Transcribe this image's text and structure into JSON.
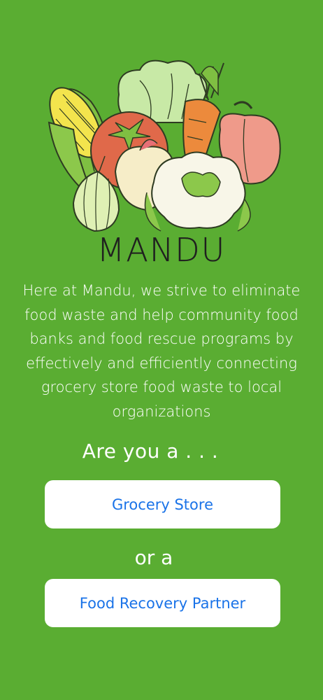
{
  "app": {
    "brand_name": "MANDU"
  },
  "intro": {
    "mission": "Here at Mandu, we strive to eliminate food waste and help community food banks and food rescue programs by effectively and efficiently connecting grocery store food waste to local organizations",
    "prompt": "Are you a . . .",
    "or_text": "or a"
  },
  "actions": {
    "grocery_label": "Grocery Store",
    "partner_label": "Food Recovery Partner"
  },
  "colors": {
    "background": "#5aad32",
    "button_bg": "#ffffff",
    "button_text": "#1a73e8",
    "logo_text": "#1f1f1f"
  },
  "icons": {
    "logo": "vegetables-illustration"
  }
}
